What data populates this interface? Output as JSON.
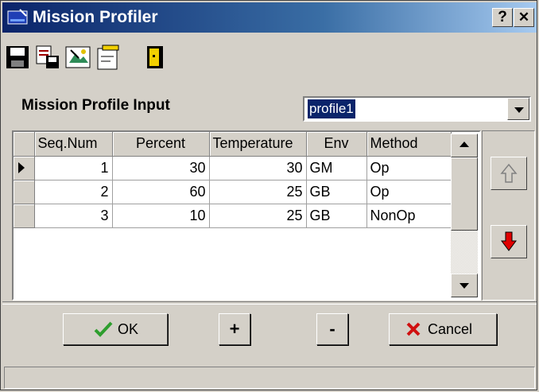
{
  "window": {
    "title": "Mission Profiler",
    "help_label": "?",
    "close_label": "✕"
  },
  "toolbar": {
    "items": [
      {
        "name": "save-icon"
      },
      {
        "name": "save-as-icon"
      },
      {
        "name": "open-icon"
      },
      {
        "name": "new-icon"
      },
      {
        "name": "exit-icon"
      }
    ]
  },
  "profile": {
    "label": "Mission Profile Input",
    "selected": "profile1"
  },
  "table": {
    "columns": [
      "Seq.Num",
      "Percent",
      "Temperature",
      "Env",
      "Method"
    ],
    "rows": [
      {
        "seq": "1",
        "percent": "30",
        "temperature": "30",
        "env": "GM",
        "method": "Op"
      },
      {
        "seq": "2",
        "percent": "60",
        "temperature": "25",
        "env": "GB",
        "method": "Op"
      },
      {
        "seq": "3",
        "percent": "10",
        "temperature": "25",
        "env": "GB",
        "method": "NonOp"
      }
    ]
  },
  "buttons": {
    "ok_label": "OK",
    "add_label": "+",
    "remove_label": "-",
    "cancel_label": "Cancel"
  },
  "colors": {
    "title_bar": "#0a246a",
    "selection": "#0a246a",
    "ok_check": "#2e9e2e",
    "cancel_x": "#d01010",
    "move_down_arrow": "#e00000"
  }
}
